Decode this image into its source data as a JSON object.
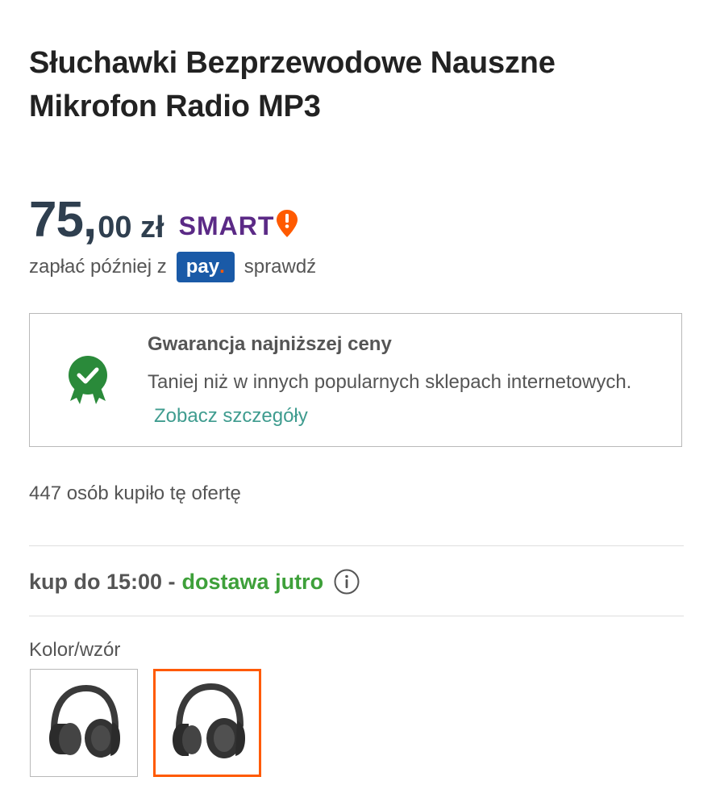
{
  "product": {
    "title": "Słuchawki Bezprzewodowe Nauszne Mikrofon Radio MP3"
  },
  "price": {
    "integer": "75,",
    "fraction": "00 zł",
    "badge": "SMART"
  },
  "pay_later": {
    "prefix": "zapłać później z",
    "provider": "pay",
    "provider_dot": ".",
    "link": "sprawdź"
  },
  "guarantee": {
    "title": "Gwarancja najniższej ceny",
    "text": "Taniej niż w innych popularnych sklepach internetowych.",
    "link": "Zobacz szczegóły"
  },
  "buyers": {
    "text": "447 osób kupiło tę ofertę"
  },
  "delivery": {
    "prefix": "kup do 15:00 -",
    "highlight": "dostawa jutro"
  },
  "variants": {
    "label": "Kolor/wzór",
    "selected_index": 1
  },
  "colors": {
    "price": "#2f3f4f",
    "smart": "#5b2a86",
    "smart_mark": "#ff5a00",
    "pay_badge": "#1a5aa7",
    "link": "#3f9c8f",
    "delivery": "#3ea03a",
    "selected_border": "#ff5a00",
    "guarantee_icon": "#2a8a3a"
  },
  "icons": [
    "smart-pin-icon",
    "guarantee-badge-icon",
    "info-icon",
    "headphones-icon"
  ]
}
